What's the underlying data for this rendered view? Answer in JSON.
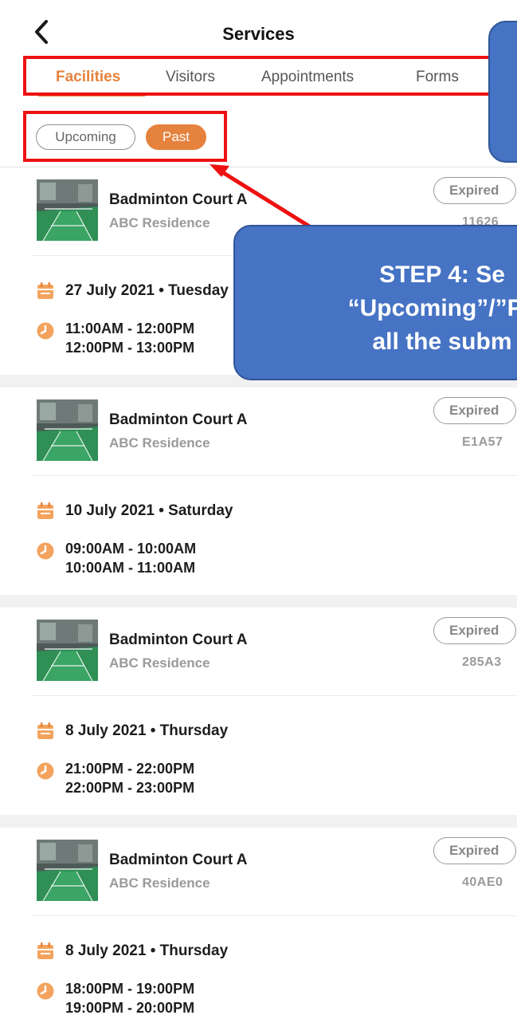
{
  "header": {
    "title": "Services",
    "back_icon": "chevron-left-icon"
  },
  "tabs": [
    "Facilities",
    "Visitors",
    "Appointments",
    "Forms"
  ],
  "active_tab": "Facilities",
  "filters": {
    "upcoming": "Upcoming",
    "past": "Past",
    "active": "Past"
  },
  "accent_color": "#e5823e",
  "bookings": [
    {
      "facility": "Badminton Court A",
      "location": "ABC Residence",
      "status": "Expired",
      "code": "11626",
      "date": "27 July 2021 • Tuesday",
      "times": [
        "11:00AM - 12:00PM",
        "12:00PM - 13:00PM"
      ]
    },
    {
      "facility": "Badminton Court A",
      "location": "ABC Residence",
      "status": "Expired",
      "code": "E1A57",
      "date": "10 July 2021 • Saturday",
      "times": [
        "09:00AM - 10:00AM",
        "10:00AM - 11:00AM"
      ]
    },
    {
      "facility": "Badminton Court A",
      "location": "ABC Residence",
      "status": "Expired",
      "code": "285A3",
      "date": "8 July 2021 • Thursday",
      "times": [
        "21:00PM - 22:00PM",
        "22:00PM - 23:00PM"
      ]
    },
    {
      "facility": "Badminton Court A",
      "location": "ABC Residence",
      "status": "Expired",
      "code": "40AE0",
      "date": "8 July 2021 • Thursday",
      "times": [
        "18:00PM - 19:00PM",
        "19:00PM - 20:00PM"
      ]
    }
  ],
  "annotation": {
    "callout_text": "STEP 4: Se\n“Upcoming”/”Pa\nall the subm",
    "callout_color": "#4673c4",
    "highlight_color": "#ee1111"
  }
}
